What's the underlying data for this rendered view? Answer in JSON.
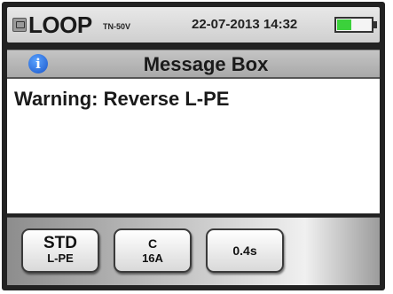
{
  "status_bar": {
    "mode": "LOOP",
    "mode_sub": "TN-50V",
    "datetime": "22-07-2013 14:32",
    "battery_level": 0.4,
    "battery_color": "#3bd13b"
  },
  "message_box": {
    "title": "Message Box",
    "info_icon": "i",
    "message": "Warning: Reverse L-PE"
  },
  "softkeys": [
    {
      "line1": "STD",
      "line2": "L-PE"
    },
    {
      "line1": "C",
      "line2": "16A"
    },
    {
      "label": "0.4s"
    }
  ]
}
